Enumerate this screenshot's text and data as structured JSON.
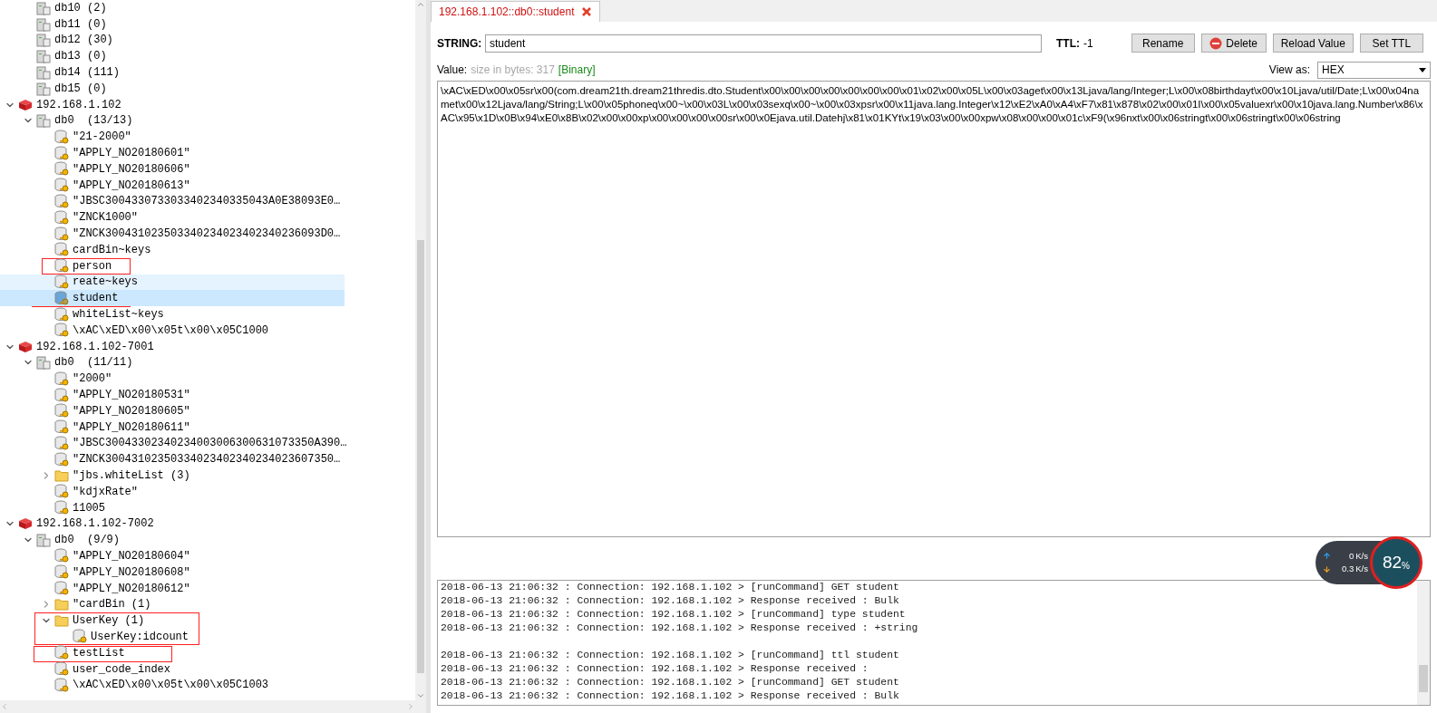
{
  "tree_partial": [
    {
      "kind": "database",
      "label": "db10 (2)",
      "selected": false,
      "hovered": false
    },
    {
      "kind": "database",
      "label": "db11 (0)",
      "selected": false,
      "hovered": false
    },
    {
      "kind": "database",
      "label": "db12 (30)",
      "selected": false,
      "hovered": false
    },
    {
      "kind": "database",
      "label": "db13 (0)",
      "selected": false,
      "hovered": false
    },
    {
      "kind": "database",
      "label": "db14 (111)",
      "selected": false,
      "hovered": false
    },
    {
      "kind": "database",
      "label": "db15 (0)",
      "selected": false,
      "hovered": false
    }
  ],
  "tree": [
    {
      "kind": "server",
      "label": "192.168.1.102",
      "expanded": true,
      "selected": false,
      "hovered": false,
      "children": [
        {
          "kind": "database",
          "label": "db0  (13/13)",
          "expanded": true,
          "selected": false,
          "hovered": false,
          "children": [
            {
              "kind": "key",
              "label": "\"21-2000\"",
              "selected": false,
              "hovered": false
            },
            {
              "kind": "key",
              "label": "\"APPLY_NO20180601\"",
              "selected": false,
              "hovered": false
            },
            {
              "kind": "key",
              "label": "\"APPLY_NO20180606\"",
              "selected": false,
              "hovered": false
            },
            {
              "kind": "key",
              "label": "\"APPLY_NO20180613\"",
              "selected": false,
              "hovered": false
            },
            {
              "kind": "key",
              "label": "\"JBSC3004330733033402340335043A0E38093E0…",
              "selected": false,
              "hovered": false
            },
            {
              "kind": "key",
              "label": "\"ZNCK1000\"",
              "selected": false,
              "hovered": false
            },
            {
              "kind": "key",
              "label": "\"ZNCK300431023503340234023402340236093D0…",
              "selected": false,
              "hovered": false
            },
            {
              "kind": "key",
              "label": "cardBin~keys",
              "selected": false,
              "hovered": false
            },
            {
              "kind": "key",
              "label": "person",
              "selected": false,
              "hovered": false
            },
            {
              "kind": "key",
              "label": "reate~keys",
              "selected": false,
              "hovered": true
            },
            {
              "kind": "key",
              "label": "student",
              "selected": true,
              "hovered": false
            },
            {
              "kind": "key",
              "label": "whiteList~keys",
              "selected": false,
              "hovered": false
            },
            {
              "kind": "key",
              "label": "\\xAC\\xED\\x00\\x05t\\x00\\x05C1000",
              "selected": false,
              "hovered": false
            }
          ]
        }
      ]
    },
    {
      "kind": "server",
      "label": "192.168.1.102-7001",
      "expanded": true,
      "selected": false,
      "hovered": false,
      "children": [
        {
          "kind": "database",
          "label": "db0  (11/11)",
          "expanded": true,
          "selected": false,
          "hovered": false,
          "children": [
            {
              "kind": "key",
              "label": "\"2000\"",
              "selected": false,
              "hovered": false
            },
            {
              "kind": "key",
              "label": "\"APPLY_NO20180531\"",
              "selected": false,
              "hovered": false
            },
            {
              "kind": "key",
              "label": "\"APPLY_NO20180605\"",
              "selected": false,
              "hovered": false
            },
            {
              "kind": "key",
              "label": "\"APPLY_NO20180611\"",
              "selected": false,
              "hovered": false
            },
            {
              "kind": "key",
              "label": "\"JBSC30043302340234003006300631073350A390…",
              "selected": false,
              "hovered": false
            },
            {
              "kind": "key",
              "label": "\"ZNCK30043102350334023402340234023607350…",
              "selected": false,
              "hovered": false
            },
            {
              "kind": "folder",
              "label": "\"jbs.whiteList (3)",
              "expanded": false,
              "selected": false,
              "hovered": false
            },
            {
              "kind": "key",
              "label": "\"kdjxRate\"",
              "selected": false,
              "hovered": false
            },
            {
              "kind": "key",
              "label": "11005",
              "selected": false,
              "hovered": false
            }
          ]
        }
      ]
    },
    {
      "kind": "server",
      "label": "192.168.1.102-7002",
      "expanded": true,
      "selected": false,
      "hovered": false,
      "children": [
        {
          "kind": "database",
          "label": "db0  (9/9)",
          "expanded": true,
          "selected": false,
          "hovered": false,
          "children": [
            {
              "kind": "key",
              "label": "\"APPLY_NO20180604\"",
              "selected": false,
              "hovered": false
            },
            {
              "kind": "key",
              "label": "\"APPLY_NO20180608\"",
              "selected": false,
              "hovered": false
            },
            {
              "kind": "key",
              "label": "\"APPLY_NO20180612\"",
              "selected": false,
              "hovered": false
            },
            {
              "kind": "folder",
              "label": "\"cardBin (1)",
              "expanded": false,
              "selected": false,
              "hovered": false
            },
            {
              "kind": "folder",
              "label": "UserKey (1)",
              "expanded": true,
              "selected": false,
              "hovered": false,
              "children": [
                {
                  "kind": "key",
                  "label": "UserKey:idcount",
                  "selected": false,
                  "hovered": false
                }
              ]
            },
            {
              "kind": "key",
              "label": "testList",
              "selected": false,
              "hovered": false
            },
            {
              "kind": "key",
              "label": "user_code_index",
              "selected": false,
              "hovered": false
            },
            {
              "kind": "key",
              "label": "\\xAC\\xED\\x00\\x05t\\x00\\x05C1003",
              "selected": false,
              "hovered": false
            }
          ]
        }
      ]
    }
  ],
  "tab": {
    "label": "192.168.1.102::db0::student",
    "selected": true
  },
  "key_bar": {
    "type_label": "STRING:",
    "key_name": "student",
    "ttl_label": "TTL:",
    "ttl_value": "-1",
    "buttons": [
      {
        "kind": "plain",
        "label": "Rename"
      },
      {
        "kind": "delete",
        "label": "Delete"
      },
      {
        "kind": "plain",
        "label": "Reload Value"
      },
      {
        "kind": "plain",
        "label": "Set TTL"
      }
    ]
  },
  "value_bar": {
    "label": "Value:",
    "size": "size in bytes: 317",
    "format_tag": "[Binary]",
    "view_label": "View as:",
    "view_mode": "HEX"
  },
  "value": "\\xAC\\xED\\x00\\x05sr\\x00(com.dream21th.dream21thredis.dto.Student\\x00\\x00\\x00\\x00\\x00\\x00\\x00\\x01\\x02\\x00\\x05L\\x00\\x03aget\\x00\\x13Ljava/lang/Integer;L\\x00\\x08birthdayt\\x00\\x10Ljava/util/Date;L\\x00\\x04namet\\x00\\x12Ljava/lang/String;L\\x00\\x05phoneq\\x00~\\x00\\x03L\\x00\\x03sexq\\x00~\\x00\\x03xpsr\\x00\\x11java.lang.Integer\\x12\\xE2\\xA0\\xA4\\xF7\\x81\\x878\\x02\\x00\\x01I\\x00\\x05valuexr\\x00\\x10java.lang.Number\\x86\\xAC\\x95\\x1D\\x0B\\x94\\xE0\\x8B\\x02\\x00\\x00xp\\x00\\x00\\x00\\x00sr\\x00\\x0Ejava.util.Datehj\\x81\\x01KYt\\x19\\x03\\x00\\x00xpw\\x08\\x00\\x00\\x01c\\xF9(\\x96nxt\\x00\\x06stringt\\x00\\x06stringt\\x00\\x06string",
  "log": [
    {
      "text": "2018-06-13 21:06:32 : Connection: 192.168.1.102 > [runCommand] GET student"
    },
    {
      "text": "2018-06-13 21:06:32 : Connection: 192.168.1.102 > Response received : Bulk"
    },
    {
      "text": "2018-06-13 21:06:32 : Connection: 192.168.1.102 > [runCommand] type student"
    },
    {
      "text": "2018-06-13 21:06:32 : Connection: 192.168.1.102 > Response received : +string"
    },
    {
      "text": "2018-06-13 21:06:32 : Connection: 192.168.1.102 > [runCommand] ttl student",
      "kind": "after_gap"
    },
    {
      "text": "2018-06-13 21:06:32 : Connection: 192.168.1.102 > Response received :"
    },
    {
      "text": "2018-06-13 21:06:32 : Connection: 192.168.1.102 > [runCommand] GET student"
    },
    {
      "text": "2018-06-13 21:06:32 : Connection: 192.168.1.102 > Response received : Bulk"
    }
  ],
  "net_widget": {
    "upload": "0",
    "upload_unit": "K/s",
    "download": "0.3",
    "download_unit": "K/s",
    "percent": "82",
    "percent_sign": "%"
  }
}
